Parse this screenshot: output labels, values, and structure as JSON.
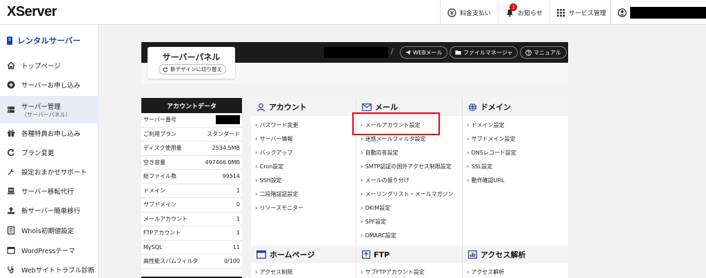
{
  "header": {
    "logo": "XServer",
    "items": [
      {
        "name": "billing",
        "label": "料金支払い",
        "icon": "yen-icon"
      },
      {
        "name": "notifications",
        "label": "お知らせ",
        "icon": "bell-icon",
        "badge": "3"
      },
      {
        "name": "services",
        "label": "サービス管理",
        "icon": "grid-icon"
      }
    ]
  },
  "sidebar": {
    "title": "レンタルサーバー",
    "items": [
      {
        "label": "トップページ",
        "icon": "home-icon"
      },
      {
        "label": "サーバーお申し込み",
        "icon": "plus-circle-icon"
      },
      {
        "label": "サーバー管理",
        "sub": "（サーバーパネル）",
        "icon": "server-icon",
        "active": true
      },
      {
        "label": "各種特典お申し込み",
        "icon": "gift-icon"
      },
      {
        "label": "プラン変更",
        "icon": "refresh-icon"
      },
      {
        "label": "設定おまかせサポート",
        "icon": "wrench-icon"
      },
      {
        "label": "サーバー移転代行",
        "icon": "truck-icon"
      },
      {
        "label": "新サーバー簡単移行",
        "icon": "upload-icon"
      },
      {
        "label": "Whois初期値設定",
        "icon": "document-icon"
      },
      {
        "label": "WordPressテーマ",
        "icon": "window-icon"
      },
      {
        "label": "Webサイトトラブル診断",
        "icon": "stethoscope-icon"
      }
    ]
  },
  "panel": {
    "title": "サーバーパネル",
    "switch_label": "新デザインに切り替え",
    "slash": "/",
    "buttons": [
      {
        "label": "WEBメール",
        "icon": "send-icon"
      },
      {
        "label": "ファイルマネージャ",
        "icon": "folder-icon"
      },
      {
        "label": "マニュアル",
        "icon": "help-icon"
      }
    ]
  },
  "account_data": {
    "title": "アカウントデータ",
    "rows": [
      {
        "label": "サーバー番号",
        "value": ""
      },
      {
        "label": "ご利用プラン",
        "value": "スタンダード"
      },
      {
        "label": "ディスク使用量",
        "value": "2534.5MB"
      },
      {
        "label": "空き容量",
        "value": "497466.0MB"
      },
      {
        "label": "総ファイル数",
        "value": "99514"
      },
      {
        "label": "ドメイン",
        "value": "1"
      },
      {
        "label": "サブドメイン",
        "value": "0"
      },
      {
        "label": "メールアカウント",
        "value": "1"
      },
      {
        "label": "FTPアカウント",
        "value": "1"
      },
      {
        "label": "MySQL",
        "value": "11"
      },
      {
        "label": "高性能スパムフィルタ",
        "value": "0/100"
      }
    ]
  },
  "menu": {
    "account": {
      "title": "アカウント",
      "links": [
        "パスワード変更",
        "サーバー情報",
        "バックアップ",
        "Cron設定",
        "SSH設定",
        "二段階認証設定",
        "リソースモニター"
      ]
    },
    "mail": {
      "title": "メール",
      "links": [
        "メールアカウント設定",
        "迷惑メールフィルタ設定",
        "自動応答設定",
        "SMTP認証の国外アクセス制限設定",
        "メールの振り分け",
        "メーリングリスト・メールマガジン",
        "DKIM設定",
        "SPF設定",
        "DMARC設定"
      ]
    },
    "domain": {
      "title": "ドメイン",
      "links": [
        "ドメイン設定",
        "サブドメイン設定",
        "DNSレコード設定",
        "SSL設定",
        "動作確認URL"
      ]
    },
    "homepage": {
      "title": "ホームページ",
      "links": [
        "アクセス制限"
      ]
    },
    "ftp": {
      "title": "FTP",
      "links": [
        "サブFTPアカウント設定"
      ]
    },
    "access": {
      "title": "アクセス解析",
      "links": [
        "アクセス解析"
      ]
    }
  },
  "colors": {
    "accent_blue": "#1a3fa6",
    "highlight_red": "#e60012",
    "panel_dark": "#1c1c1c"
  }
}
